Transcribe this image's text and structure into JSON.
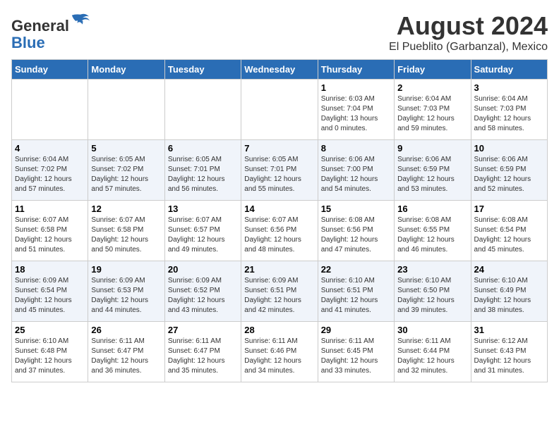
{
  "header": {
    "logo_line1": "General",
    "logo_line2": "Blue",
    "main_title": "August 2024",
    "subtitle": "El Pueblito (Garbanzal), Mexico"
  },
  "days_of_week": [
    "Sunday",
    "Monday",
    "Tuesday",
    "Wednesday",
    "Thursday",
    "Friday",
    "Saturday"
  ],
  "weeks": [
    [
      {
        "day": "",
        "info": ""
      },
      {
        "day": "",
        "info": ""
      },
      {
        "day": "",
        "info": ""
      },
      {
        "day": "",
        "info": ""
      },
      {
        "day": "1",
        "info": "Sunrise: 6:03 AM\nSunset: 7:04 PM\nDaylight: 13 hours\nand 0 minutes."
      },
      {
        "day": "2",
        "info": "Sunrise: 6:04 AM\nSunset: 7:03 PM\nDaylight: 12 hours\nand 59 minutes."
      },
      {
        "day": "3",
        "info": "Sunrise: 6:04 AM\nSunset: 7:03 PM\nDaylight: 12 hours\nand 58 minutes."
      }
    ],
    [
      {
        "day": "4",
        "info": "Sunrise: 6:04 AM\nSunset: 7:02 PM\nDaylight: 12 hours\nand 57 minutes."
      },
      {
        "day": "5",
        "info": "Sunrise: 6:05 AM\nSunset: 7:02 PM\nDaylight: 12 hours\nand 57 minutes."
      },
      {
        "day": "6",
        "info": "Sunrise: 6:05 AM\nSunset: 7:01 PM\nDaylight: 12 hours\nand 56 minutes."
      },
      {
        "day": "7",
        "info": "Sunrise: 6:05 AM\nSunset: 7:01 PM\nDaylight: 12 hours\nand 55 minutes."
      },
      {
        "day": "8",
        "info": "Sunrise: 6:06 AM\nSunset: 7:00 PM\nDaylight: 12 hours\nand 54 minutes."
      },
      {
        "day": "9",
        "info": "Sunrise: 6:06 AM\nSunset: 6:59 PM\nDaylight: 12 hours\nand 53 minutes."
      },
      {
        "day": "10",
        "info": "Sunrise: 6:06 AM\nSunset: 6:59 PM\nDaylight: 12 hours\nand 52 minutes."
      }
    ],
    [
      {
        "day": "11",
        "info": "Sunrise: 6:07 AM\nSunset: 6:58 PM\nDaylight: 12 hours\nand 51 minutes."
      },
      {
        "day": "12",
        "info": "Sunrise: 6:07 AM\nSunset: 6:58 PM\nDaylight: 12 hours\nand 50 minutes."
      },
      {
        "day": "13",
        "info": "Sunrise: 6:07 AM\nSunset: 6:57 PM\nDaylight: 12 hours\nand 49 minutes."
      },
      {
        "day": "14",
        "info": "Sunrise: 6:07 AM\nSunset: 6:56 PM\nDaylight: 12 hours\nand 48 minutes."
      },
      {
        "day": "15",
        "info": "Sunrise: 6:08 AM\nSunset: 6:56 PM\nDaylight: 12 hours\nand 47 minutes."
      },
      {
        "day": "16",
        "info": "Sunrise: 6:08 AM\nSunset: 6:55 PM\nDaylight: 12 hours\nand 46 minutes."
      },
      {
        "day": "17",
        "info": "Sunrise: 6:08 AM\nSunset: 6:54 PM\nDaylight: 12 hours\nand 45 minutes."
      }
    ],
    [
      {
        "day": "18",
        "info": "Sunrise: 6:09 AM\nSunset: 6:54 PM\nDaylight: 12 hours\nand 45 minutes."
      },
      {
        "day": "19",
        "info": "Sunrise: 6:09 AM\nSunset: 6:53 PM\nDaylight: 12 hours\nand 44 minutes."
      },
      {
        "day": "20",
        "info": "Sunrise: 6:09 AM\nSunset: 6:52 PM\nDaylight: 12 hours\nand 43 minutes."
      },
      {
        "day": "21",
        "info": "Sunrise: 6:09 AM\nSunset: 6:51 PM\nDaylight: 12 hours\nand 42 minutes."
      },
      {
        "day": "22",
        "info": "Sunrise: 6:10 AM\nSunset: 6:51 PM\nDaylight: 12 hours\nand 41 minutes."
      },
      {
        "day": "23",
        "info": "Sunrise: 6:10 AM\nSunset: 6:50 PM\nDaylight: 12 hours\nand 39 minutes."
      },
      {
        "day": "24",
        "info": "Sunrise: 6:10 AM\nSunset: 6:49 PM\nDaylight: 12 hours\nand 38 minutes."
      }
    ],
    [
      {
        "day": "25",
        "info": "Sunrise: 6:10 AM\nSunset: 6:48 PM\nDaylight: 12 hours\nand 37 minutes."
      },
      {
        "day": "26",
        "info": "Sunrise: 6:11 AM\nSunset: 6:47 PM\nDaylight: 12 hours\nand 36 minutes."
      },
      {
        "day": "27",
        "info": "Sunrise: 6:11 AM\nSunset: 6:47 PM\nDaylight: 12 hours\nand 35 minutes."
      },
      {
        "day": "28",
        "info": "Sunrise: 6:11 AM\nSunset: 6:46 PM\nDaylight: 12 hours\nand 34 minutes."
      },
      {
        "day": "29",
        "info": "Sunrise: 6:11 AM\nSunset: 6:45 PM\nDaylight: 12 hours\nand 33 minutes."
      },
      {
        "day": "30",
        "info": "Sunrise: 6:11 AM\nSunset: 6:44 PM\nDaylight: 12 hours\nand 32 minutes."
      },
      {
        "day": "31",
        "info": "Sunrise: 6:12 AM\nSunset: 6:43 PM\nDaylight: 12 hours\nand 31 minutes."
      }
    ]
  ]
}
